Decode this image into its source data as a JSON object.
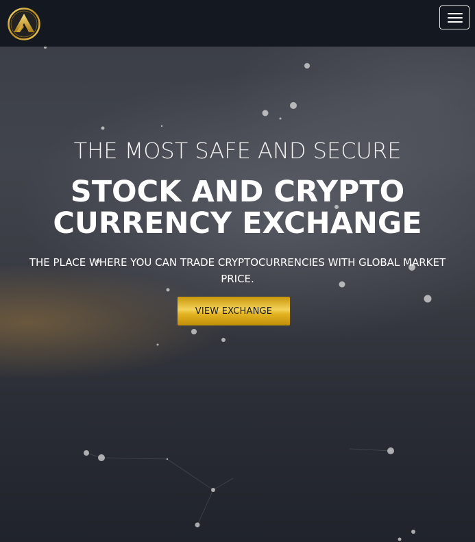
{
  "navbar": {
    "logo_icon": "gold-triangle-logo-icon",
    "menu_icon": "hamburger-menu-icon"
  },
  "hero": {
    "subtitle": "THE MOST SAFE AND SECURE",
    "headline_line1": "STOCK AND CRYPTO",
    "headline_line2": "CURRENCY EXCHANGE",
    "tagline": "THE PLACE WHERE YOU CAN TRADE CRYPTOCURRENCIES WITH GLOBAL MARKET PRICE.",
    "cta_label": "VIEW EXCHANGE"
  },
  "colors": {
    "navbar_bg": "#141820",
    "accent_gold": "#e2b322",
    "text": "#ffffff"
  }
}
